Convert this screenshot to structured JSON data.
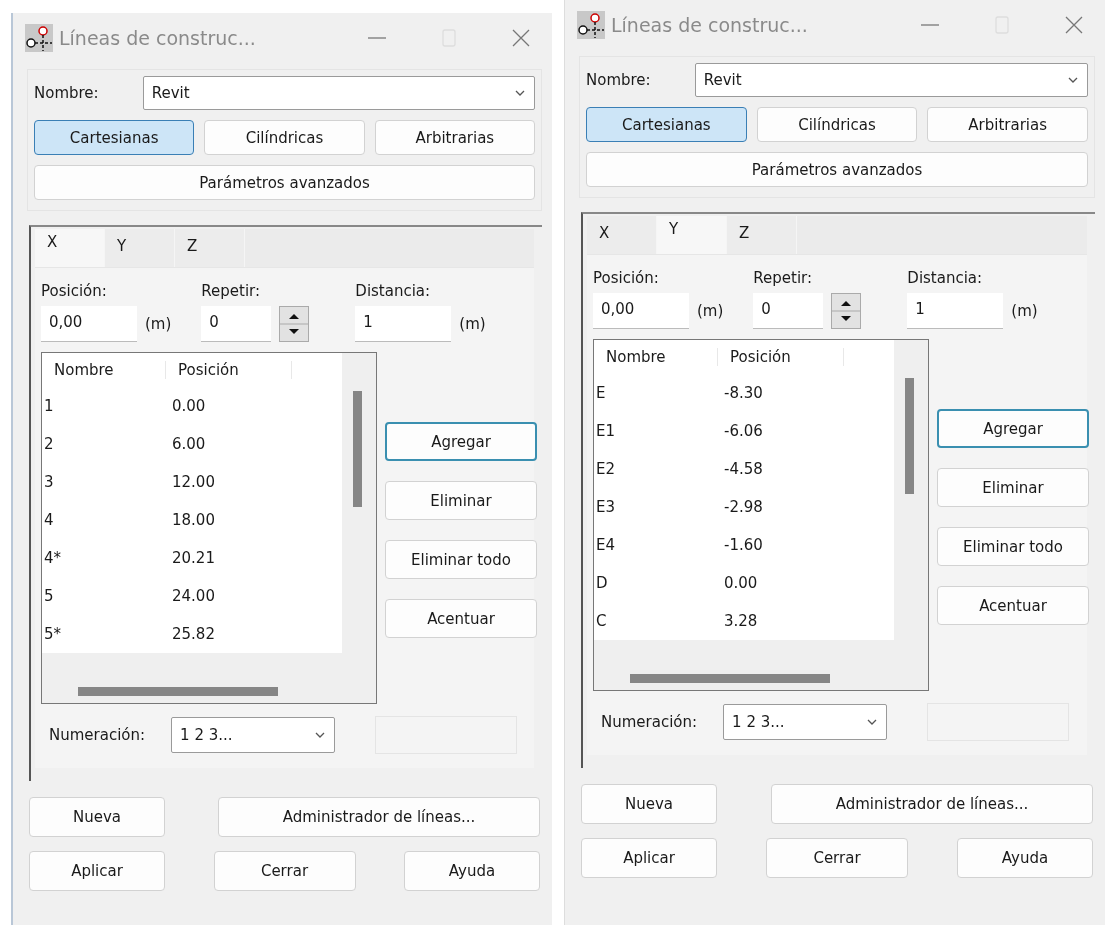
{
  "dialogs": [
    {
      "title": "Líneas de construc...",
      "name_label": "Nombre:",
      "name_value": "Revit",
      "modes": [
        {
          "label": "Cartesianas",
          "selected": true
        },
        {
          "label": "Cilíndricas",
          "selected": false
        },
        {
          "label": "Arbitrarias",
          "selected": false
        }
      ],
      "advanced_button": "Parámetros avanzados",
      "tabs": [
        {
          "label": "X",
          "selected": true
        },
        {
          "label": "Y",
          "selected": false
        },
        {
          "label": "Z",
          "selected": false
        }
      ],
      "position": {
        "label": "Posición:",
        "value": "0,00",
        "unit": "(m)"
      },
      "repeat": {
        "label": "Repetir:",
        "value": "0"
      },
      "distance": {
        "label": "Distancia:",
        "value": "1",
        "unit": "(m)"
      },
      "list": {
        "columns": [
          "Nombre",
          "Posición"
        ],
        "rows": [
          [
            "1",
            "0.00"
          ],
          [
            "2",
            "6.00"
          ],
          [
            "3",
            "12.00"
          ],
          [
            "4",
            "18.00"
          ],
          [
            "4*",
            "20.21"
          ],
          [
            "5",
            "24.00"
          ],
          [
            "5*",
            "25.82"
          ]
        ]
      },
      "side_buttons": [
        {
          "label": "Agregar",
          "default": true
        },
        {
          "label": "Eliminar",
          "default": false
        },
        {
          "label": "Eliminar todo",
          "default": false
        },
        {
          "label": "Acentuar",
          "default": false
        }
      ],
      "numbering": {
        "label": "Numeración:",
        "value": "1 2 3..."
      },
      "footer_buttons": [
        "Nueva",
        "Administrador de líneas..."
      ],
      "bottom_buttons": [
        "Aplicar",
        "Cerrar",
        "Ayuda"
      ]
    },
    {
      "title": "Líneas de construc...",
      "name_label": "Nombre:",
      "name_value": "Revit",
      "modes": [
        {
          "label": "Cartesianas",
          "selected": true
        },
        {
          "label": "Cilíndricas",
          "selected": false
        },
        {
          "label": "Arbitrarias",
          "selected": false
        }
      ],
      "advanced_button": "Parámetros avanzados",
      "tabs": [
        {
          "label": "X",
          "selected": false
        },
        {
          "label": "Y",
          "selected": true
        },
        {
          "label": "Z",
          "selected": false
        }
      ],
      "position": {
        "label": "Posición:",
        "value": "0,00",
        "unit": "(m)"
      },
      "repeat": {
        "label": "Repetir:",
        "value": "0"
      },
      "distance": {
        "label": "Distancia:",
        "value": "1",
        "unit": "(m)"
      },
      "list": {
        "columns": [
          "Nombre",
          "Posición"
        ],
        "rows": [
          [
            "E",
            "-8.30"
          ],
          [
            "E1",
            "-6.06"
          ],
          [
            "E2",
            "-4.58"
          ],
          [
            "E3",
            "-2.98"
          ],
          [
            "E4",
            "-1.60"
          ],
          [
            "D",
            "0.00"
          ],
          [
            "C",
            "3.28"
          ]
        ]
      },
      "side_buttons": [
        {
          "label": "Agregar",
          "default": true
        },
        {
          "label": "Eliminar",
          "default": false
        },
        {
          "label": "Eliminar todo",
          "default": false
        },
        {
          "label": "Acentuar",
          "default": false
        }
      ],
      "numbering": {
        "label": "Numeración:",
        "value": "1 2 3..."
      },
      "footer_buttons": [
        "Nueva",
        "Administrador de líneas..."
      ],
      "bottom_buttons": [
        "Aplicar",
        "Cerrar",
        "Ayuda"
      ]
    }
  ]
}
